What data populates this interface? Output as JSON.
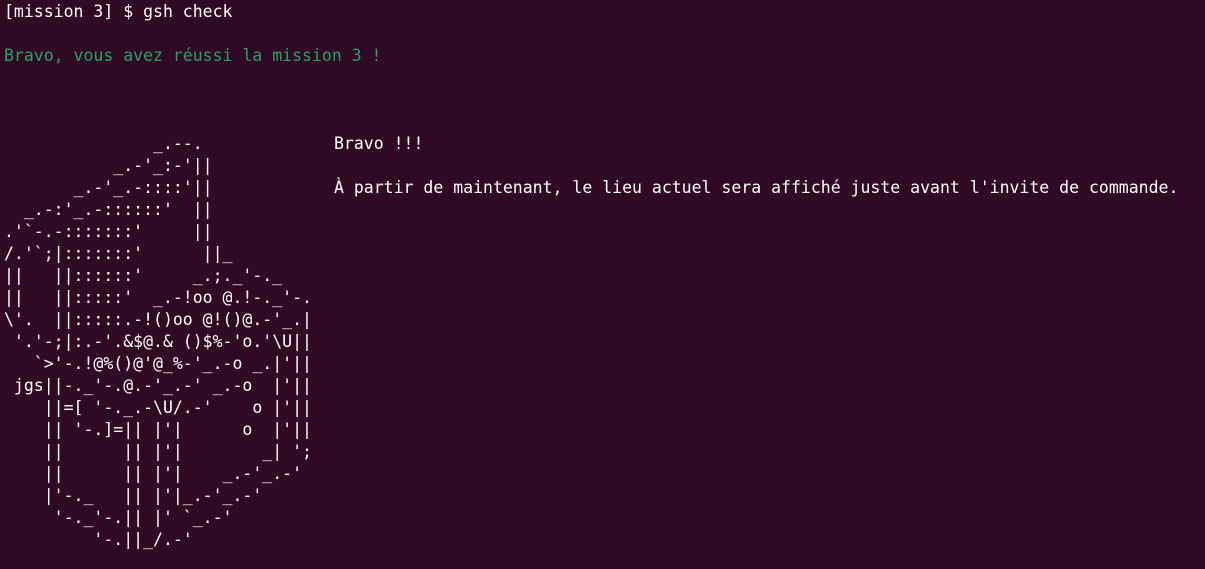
{
  "terminal": {
    "prompt": "[mission 3] $ gsh check",
    "success_message": "Bravo, vous avez réussi la mission 3 !",
    "ascii_art": "               _.--.\n           _.-'_:-'||\n       _.-'_.-::::'||\n  _.-:'_.-::::::'  ||\n.'`-.-:::::::'     ||\n/.'`;|:::::::'      ||_\n||   ||::::::'     _.;._'-._\n||   ||:::::'  _.-!oo @.!-._'-.\n\\'.  ||:::::.-!()oo @!()@.-'_.|\n '.'-;|:.-'.&$@.& ()$%-'o.'\\U||\n   `>'-.!@%()@'@_%-'_.-o _.|'||\n jgs||-._'-.@.-'_.-' _.-o  |'||\n    ||=[ '-._.-\\U/.-'    o |'||\n    || '-.]=|| |'|      o  |'||\n    ||      || |'|        _| ';\n    ||      || |'|    _.-'_.-'\n    |'-._   || |'|_.-'_.-'\n     '-._'-.|| |' `_.-'\n         '-.||_/.-'",
    "message_title": "Bravo !!!",
    "message_body": "À partir de maintenant, le lieu actuel sera affiché juste avant l'invite de commande."
  },
  "colors": {
    "background": "#300a24",
    "text": "#ffffff",
    "success": "#26a269"
  }
}
